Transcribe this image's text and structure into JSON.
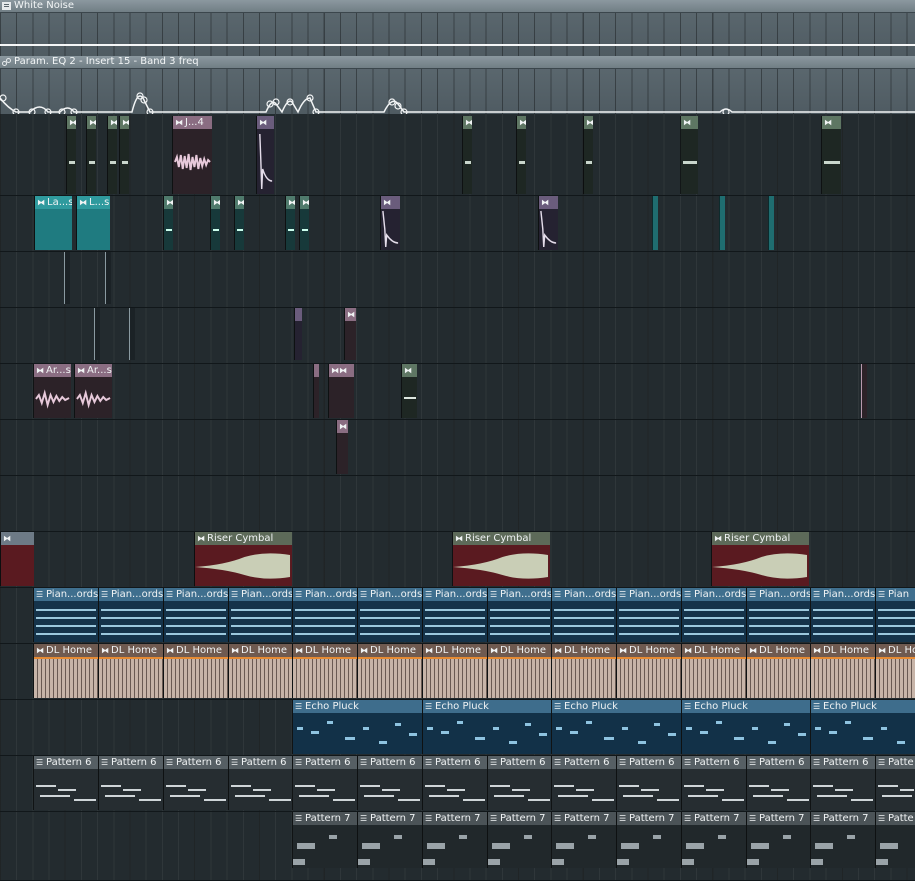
{
  "automation": [
    {
      "label": "White Noise",
      "icon": "pattern-icon"
    },
    {
      "label": "Param. EQ 2 - Insert 15 - Band 3 freq",
      "icon": "automation-link-icon"
    }
  ],
  "clips": {
    "audio_short": "J...4",
    "lead_a": "La...s",
    "lead_b": "L...s",
    "arp_a": "Ar...s",
    "arp_b": "Ar...s",
    "riser": "Riser Cymbal",
    "piano": "Pian...ords",
    "piano_cut": "Pian",
    "dl_home": "DL Home",
    "dl_home_cut": "DL Ho",
    "echo": "Echo Pluck",
    "pattern6": "Pattern 6",
    "pattern6_cut": "Patte",
    "pattern7": "Pattern 7",
    "pattern7_cut": "Patte"
  },
  "colors": {
    "piano_notes": "#9cc8dd",
    "echo_notes": "#8ec3e0",
    "riser_wave": "#c9ceb6",
    "dl_wave": "#3a2f2c"
  }
}
